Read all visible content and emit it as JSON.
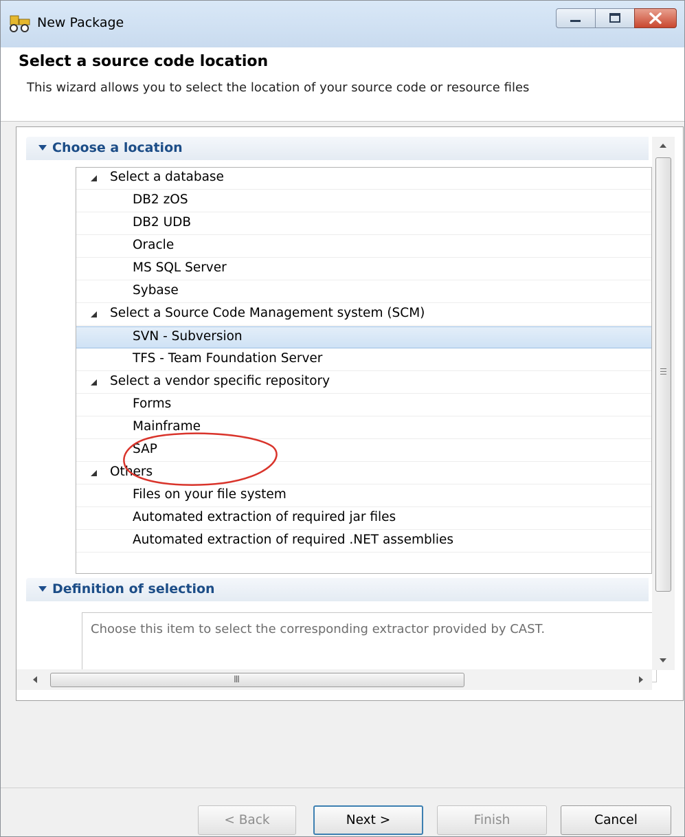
{
  "window": {
    "title": "New Package"
  },
  "header": {
    "title": "Select a source code location",
    "description": "This wizard allows you to select the location of your source code or resource files"
  },
  "location_section": {
    "label": "Choose a location",
    "tree": [
      {
        "kind": "category",
        "label": "Select a database"
      },
      {
        "kind": "item",
        "label": "DB2 zOS"
      },
      {
        "kind": "item",
        "label": "DB2 UDB"
      },
      {
        "kind": "item",
        "label": "Oracle"
      },
      {
        "kind": "item",
        "label": "MS SQL Server"
      },
      {
        "kind": "item",
        "label": "Sybase"
      },
      {
        "kind": "category",
        "label": "Select a Source Code Management system (SCM)"
      },
      {
        "kind": "item",
        "label": "SVN - Subversion",
        "selected": true
      },
      {
        "kind": "item",
        "label": "TFS - Team Foundation Server"
      },
      {
        "kind": "category",
        "label": "Select a vendor specific repository"
      },
      {
        "kind": "item",
        "label": "Forms"
      },
      {
        "kind": "item",
        "label": "Mainframe"
      },
      {
        "kind": "item",
        "label": "SAP"
      },
      {
        "kind": "category",
        "label": "Others"
      },
      {
        "kind": "item",
        "label": "Files on your file system"
      },
      {
        "kind": "item",
        "label": "Automated extraction of required jar files"
      },
      {
        "kind": "item",
        "label": "Automated extraction of required .NET assemblies"
      }
    ]
  },
  "definition_section": {
    "label": "Definition of selection",
    "text": "Choose this item to select the corresponding extractor provided by CAST."
  },
  "buttons": {
    "back": "< Back",
    "next": "Next >",
    "finish": "Finish",
    "cancel": "Cancel"
  },
  "colors": {
    "section_header_text": "#1c4d87",
    "selection_bg": "#cfe2f5",
    "annotation_circle": "#d9342b"
  }
}
